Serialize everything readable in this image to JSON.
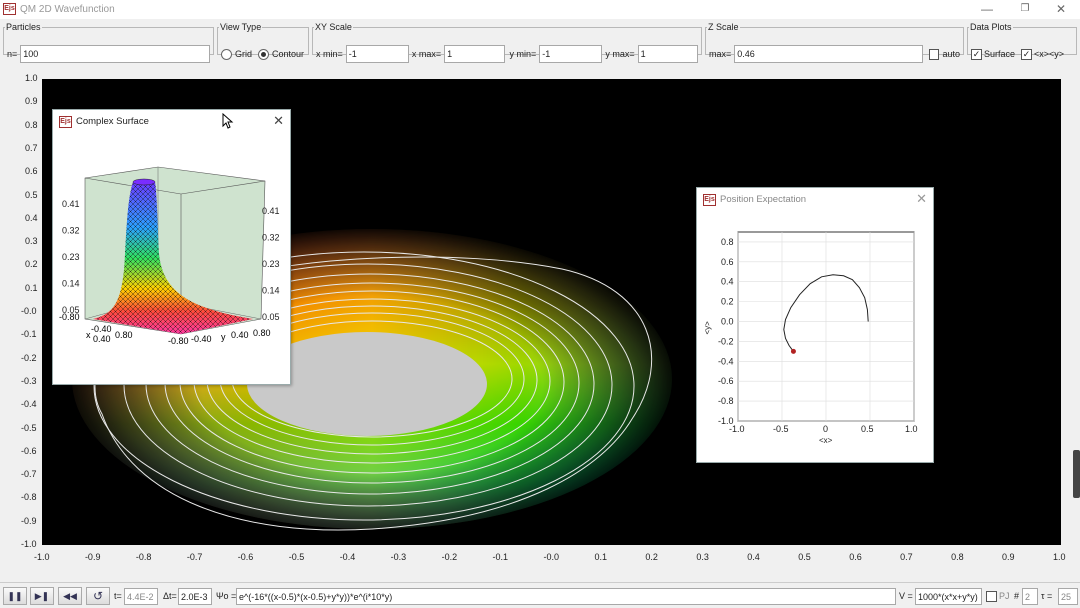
{
  "app": {
    "logo": "Ejs",
    "title": "QM 2D Wavefunction"
  },
  "window_buttons": [
    "minimize-icon",
    "restore-icon",
    "close-icon"
  ],
  "particles": {
    "legend": "Particles",
    "n_label": "n=",
    "n_value": "100"
  },
  "view_type": {
    "legend": "View Type",
    "grid_label": "Grid",
    "contour_label": "Contour",
    "selected": "Contour"
  },
  "xy_scale": {
    "legend": "XY Scale",
    "xmin_label": "x min=",
    "xmin": "-1",
    "xmax_label": "x max=",
    "xmax": "1",
    "ymin_label": "y min=",
    "ymin": "-1",
    "ymax_label": "y max=",
    "ymax": "1"
  },
  "z_scale": {
    "legend": "Z Scale",
    "max_label": "max=",
    "max": "0.46",
    "auto_label": "auto",
    "auto_checked": false
  },
  "data_plots": {
    "legend": "Data Plots",
    "surface_label": "Surface",
    "surface_checked": true,
    "xy_label": "<x><y>",
    "xy_checked": true
  },
  "main_plot": {
    "x_ticks": [
      "-1.0",
      "-0.9",
      "-0.8",
      "-0.7",
      "-0.6",
      "-0.5",
      "-0.4",
      "-0.3",
      "-0.2",
      "-0.1",
      "-0.0",
      "0.1",
      "0.2",
      "0.3",
      "0.4",
      "0.5",
      "0.6",
      "0.7",
      "0.8",
      "0.9",
      "1.0"
    ],
    "y_ticks": [
      "1.0",
      "0.9",
      "0.8",
      "0.7",
      "0.6",
      "0.5",
      "0.4",
      "0.3",
      "0.2",
      "0.1",
      "-0.0",
      "-0.1",
      "-0.2",
      "-0.3",
      "-0.4",
      "-0.5",
      "-0.6",
      "-0.7",
      "-0.8",
      "-0.9",
      "-1.0"
    ]
  },
  "complex_surface": {
    "title": "Complex Surface",
    "z_ticks_left": [
      "0.41",
      "0.32",
      "0.23",
      "0.14",
      "0.05"
    ],
    "z_ticks_right": [
      "0.41",
      "0.32",
      "0.23",
      "0.14",
      "0.05"
    ],
    "x_axis_labels": [
      "-0.80",
      "-0.40",
      "0.40",
      "0.80"
    ],
    "y_axis_labels": [
      "-0.80",
      "-0.40",
      "0.40",
      "0.80"
    ],
    "x_name": "x",
    "y_name": "y"
  },
  "position_expectation": {
    "title": "Position Expectation",
    "chart_data": {
      "type": "line",
      "xlabel": "<x>",
      "ylabel": "<y>",
      "xlim": [
        -1.0,
        1.0
      ],
      "ylim": [
        -1.0,
        0.9
      ],
      "x_ticks": [
        "-1.0",
        "-0.5",
        "0",
        "0.5",
        "1.0"
      ],
      "y_ticks": [
        "0.8",
        "0.6",
        "0.4",
        "0.2",
        "0.0",
        "-0.2",
        "-0.4",
        "-0.6",
        "-0.8",
        "-1.0"
      ],
      "series": [
        {
          "x": [
            0.48,
            0.47,
            0.44,
            0.38,
            0.3,
            0.2,
            0.08,
            -0.05,
            -0.18,
            -0.3,
            -0.4,
            -0.46,
            -0.48,
            -0.46,
            -0.42,
            -0.37
          ],
          "y": [
            0.0,
            0.12,
            0.24,
            0.34,
            0.42,
            0.46,
            0.47,
            0.45,
            0.38,
            0.27,
            0.14,
            0.02,
            -0.08,
            -0.17,
            -0.24,
            -0.3
          ]
        }
      ],
      "current_point": {
        "x": -0.37,
        "y": -0.3
      },
      "grid": true
    }
  },
  "bottom": {
    "t_label": "t=",
    "t_value": "4.4E-2",
    "dt_label": "Δt=",
    "dt_value": "2.0E-3",
    "psi_label": "Ψo =",
    "psi_value": "e^(-16*((x-0.5)*(x-0.5)+y*y))*e^(i*10*y)",
    "v_label": "V =",
    "v_value": "1000*(x*x+y*y)",
    "pj_label": "PJ",
    "hash_label": "#",
    "hash_value": "2",
    "tau_label": "τ =",
    "tau_value": "25"
  },
  "colors": {
    "plot_bg": "#000000",
    "contour": "#e8e8e8",
    "flat_region": "#c9c9c9",
    "pe_curve": "#222222",
    "pe_point": "#b22222"
  }
}
